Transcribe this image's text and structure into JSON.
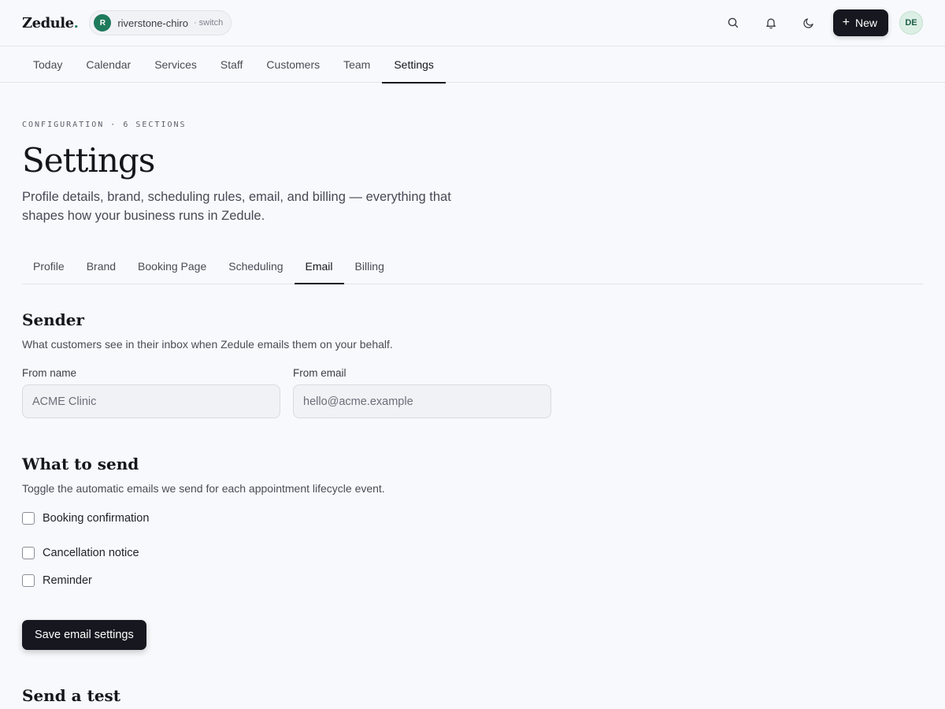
{
  "app": {
    "logo_text": "Zedule",
    "logo_dot": ".",
    "brand_color": "#1f7a5c"
  },
  "workspace": {
    "initial": "R",
    "name": "riverstone-chiro",
    "switch_label": "· switch"
  },
  "header": {
    "icons": [
      "search-icon",
      "bell-icon",
      "moon-icon"
    ],
    "new_button_label": "New",
    "user_initials": "DE"
  },
  "nav": {
    "tabs": [
      {
        "label": "Today"
      },
      {
        "label": "Calendar"
      },
      {
        "label": "Services"
      },
      {
        "label": "Staff"
      },
      {
        "label": "Customers"
      },
      {
        "label": "Team"
      },
      {
        "label": "Settings"
      }
    ],
    "active": "Settings"
  },
  "page": {
    "eyebrow": "CONFIGURATION · 6 SECTIONS",
    "title": "Settings",
    "description": "Profile details, brand, scheduling rules, email, and billing — everything that shapes how your business runs in Zedule."
  },
  "settings_tabs": {
    "tabs": [
      {
        "label": "Profile"
      },
      {
        "label": "Brand"
      },
      {
        "label": "Booking Page"
      },
      {
        "label": "Scheduling"
      },
      {
        "label": "Email"
      },
      {
        "label": "Billing"
      }
    ],
    "active": "Email"
  },
  "sender": {
    "title": "Sender",
    "description": "What customers see in their inbox when Zedule emails them on your behalf.",
    "from_name_label": "From name",
    "from_name_value": "ACME Clinic",
    "from_email_label": "From email",
    "from_email_value": "hello@acme.example"
  },
  "what_to_send": {
    "title": "What to send",
    "description": "Toggle the automatic emails we send for each appointment lifecycle event.",
    "options": [
      {
        "label": "Booking confirmation",
        "checked": false
      },
      {
        "label": "Cancellation notice",
        "checked": false
      },
      {
        "label": "Reminder",
        "checked": false
      }
    ],
    "save_label": "Save email settings"
  },
  "send_test": {
    "title": "Send a test"
  }
}
